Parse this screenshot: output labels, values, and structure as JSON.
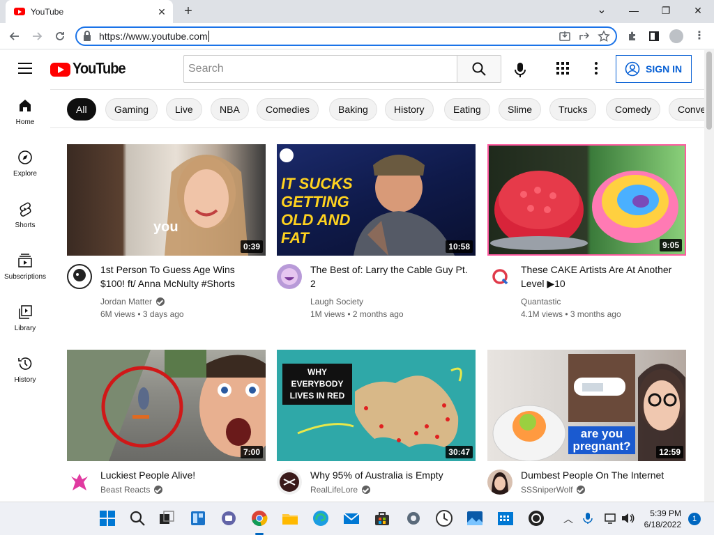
{
  "browser": {
    "tab_title": "YouTube",
    "tab_close": "✕",
    "new_tab": "+",
    "url": "https://www.youtube.com",
    "win_minimize": "—",
    "win_restore": "❐",
    "win_close": "✕",
    "tab_search": "⌄"
  },
  "header": {
    "logo_text": "YouTube",
    "search_placeholder": "Search",
    "signin_label": "SIGN IN"
  },
  "chips": [
    "All",
    "Gaming",
    "Live",
    "NBA",
    "Comedies",
    "Baking",
    "History",
    "Eating",
    "Slime",
    "Trucks",
    "Comedy",
    "Conve"
  ],
  "guide": [
    {
      "label": "Home",
      "icon": "home-icon"
    },
    {
      "label": "Explore",
      "icon": "compass-icon"
    },
    {
      "label": "Shorts",
      "icon": "shorts-icon"
    },
    {
      "label": "Subscriptions",
      "icon": "subscriptions-icon"
    },
    {
      "label": "Library",
      "icon": "library-icon"
    },
    {
      "label": "History",
      "icon": "history-icon"
    }
  ],
  "videos": [
    {
      "title": "1st Person To Guess Age Wins $100! ft/ Anna McNulty #Shorts",
      "channel": "Jordan Matter",
      "views": "6M views",
      "age": "3 days ago",
      "duration": "0:39",
      "thumb_text": "you"
    },
    {
      "title": "The Best of: Larry the Cable Guy Pt. 2",
      "channel": "Laugh Society",
      "views": "1M views",
      "age": "2 months ago",
      "duration": "10:58",
      "thumb_text": "IT SUCKS GETTING OLD AND FAT"
    },
    {
      "title": "These CAKE Artists Are At Another Level ▶10",
      "channel": "Quantastic",
      "views": "4.1M views",
      "age": "3 months ago",
      "duration": "9:05"
    },
    {
      "title": "Luckiest People Alive!",
      "channel": "Beast Reacts",
      "duration": "7:00"
    },
    {
      "title": "Why 95% of Australia is Empty",
      "channel": "RealLifeLore",
      "duration": "30:47",
      "thumb_text": "WHY EVERYBODY LIVES IN RED"
    },
    {
      "title": "Dumbest People On The Internet",
      "channel": "SSSniperWolf",
      "duration": "12:59",
      "thumb_text": "are you pregnant?"
    }
  ],
  "taskbar": {
    "time": "5:39 PM",
    "date": "6/18/2022",
    "notifications": "1"
  },
  "colors": {
    "brand_red": "#ff0000",
    "link_blue": "#065fd4",
    "focus_blue": "#1a73e8"
  }
}
